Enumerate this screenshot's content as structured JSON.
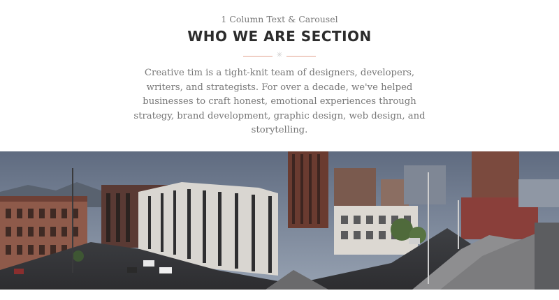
{
  "section": {
    "eyebrow": "1 Column Text & Carousel",
    "title": "WHO WE ARE SECTION",
    "divider_icon": "star-icon",
    "description": "Creative tim is a tight-knit team of designers, developers, writers, and strategists. For over a decade, we've helped businesses to craft honest, emotional experiences through strategy, brand development, graphic design, web design, and storytelling."
  },
  "carousel": {
    "image": "panoramic-city-photo",
    "colors": {
      "sky": "#6f7d93",
      "street": "#4a4a4c",
      "accent": "#e2a38f"
    }
  }
}
